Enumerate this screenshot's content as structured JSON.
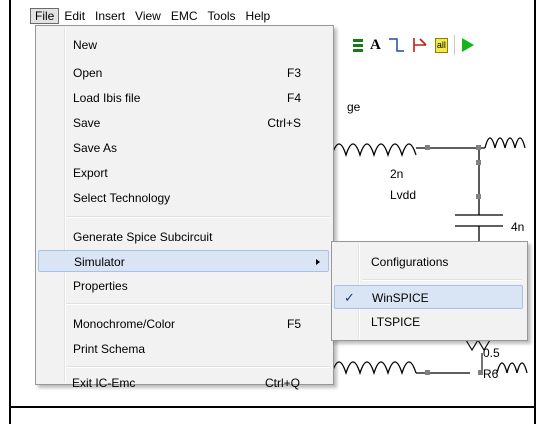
{
  "menubar": {
    "items": [
      "File",
      "Edit",
      "Insert",
      "View",
      "EMC",
      "Tools",
      "Help"
    ],
    "active": "File"
  },
  "toolbar": {
    "icons": [
      "component-icon",
      "text-icon",
      "wire-icon",
      "probe-icon",
      "label-icon",
      "run-icon"
    ],
    "text_tool_label": "A",
    "label_tool_label": "all",
    "run_color": "#17b31a"
  },
  "file_menu": {
    "items": [
      {
        "label": "New",
        "shortcut": ""
      },
      {
        "label": "Open",
        "shortcut": "F3"
      },
      {
        "label": "Load Ibis file",
        "shortcut": "F4"
      },
      {
        "label": "Save",
        "shortcut": "Ctrl+S"
      },
      {
        "label": "Save As",
        "shortcut": ""
      },
      {
        "label": "Export",
        "shortcut": ""
      },
      {
        "label": "Select Technology",
        "shortcut": ""
      },
      {
        "label": "Generate Spice Subcircuit",
        "shortcut": ""
      },
      {
        "label": "Simulator",
        "shortcut": "",
        "has_submenu": true,
        "highlighted": true
      },
      {
        "label": "Properties",
        "shortcut": ""
      },
      {
        "label": "Monochrome/Color",
        "shortcut": "F5"
      },
      {
        "label": "Print Schema",
        "shortcut": ""
      },
      {
        "label": "Exit IC-Emc",
        "shortcut": "Ctrl+Q"
      }
    ]
  },
  "simulator_submenu": {
    "items": [
      {
        "label": "Configurations"
      },
      {
        "label": "WinSPICE",
        "checked": true,
        "highlighted": true
      },
      {
        "label": "LTSPICE"
      }
    ],
    "check_glyph": "✓"
  },
  "schematic": {
    "partial_label": "ge",
    "value_2n": "2n",
    "lvdd": "Lvdd",
    "cap_value": "4n",
    "res_value": "0.5",
    "res_name": "R6"
  }
}
